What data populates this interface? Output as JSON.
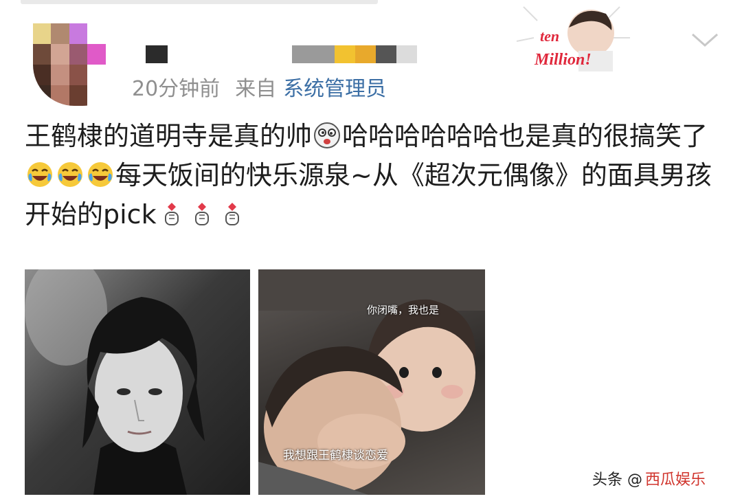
{
  "post": {
    "time": "20分钟前",
    "source_prefix": "来自",
    "source": "系统管理员",
    "text_part1": "王鹤棣的道明寺是真的帅",
    "text_part2": "哈哈哈哈哈哈也是真的很搞笑了",
    "text_part3": "每天饭间的快乐源泉~从《超次元偶像》的面具男孩开始的pick",
    "badge_line1": "ten",
    "badge_line2": "Million!"
  },
  "images": {
    "photo2_caption_top": "你闭嘴，我也是",
    "photo2_caption_bottom": "我想跟王鹤棣谈恋爱"
  },
  "watermark": {
    "prefix": "头条 @",
    "brand": "西瓜娱乐"
  },
  "colors": {
    "link": "#3c6fa5",
    "meta": "#8f8f8f",
    "text": "#1d1d1d"
  },
  "icons": [
    "dizzy-face-icon",
    "laughing-tears-icon",
    "finger-heart-icon",
    "chevron-down-icon"
  ]
}
